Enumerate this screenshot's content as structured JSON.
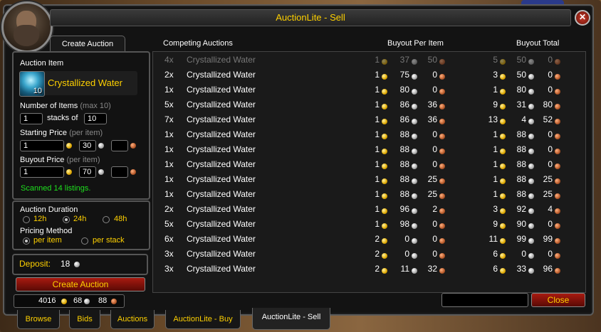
{
  "window": {
    "title": "AuctionLite - Sell",
    "close_symbol": "✕"
  },
  "left": {
    "tab_label": "Create Auction",
    "auction_item_label": "Auction Item",
    "item_name": "Crystallized Water",
    "item_count": "10",
    "num_items_label": "Number of Items",
    "num_items_max": "(max 10)",
    "stacks_value": "1",
    "stacks_of_label": "stacks of",
    "stack_size_value": "10",
    "starting_price_label": "Starting Price",
    "per_item_hint": "(per item)",
    "start_gold": "1",
    "start_silver": "30",
    "start_copper": "",
    "buyout_price_label": "Buyout Price",
    "buyout_gold": "1",
    "buyout_silver": "70",
    "buyout_copper": "",
    "scanned_text": "Scanned 14 listings.",
    "duration_label": "Auction Duration",
    "dur_12": "12h",
    "dur_24": "24h",
    "dur_48": "48h",
    "pricing_label": "Pricing Method",
    "per_item": "per item",
    "per_stack": "per stack",
    "deposit_label": "Deposit:",
    "deposit_value": "18",
    "create_button": "Create Auction",
    "money_gold": "4016",
    "money_silver": "68",
    "money_copper": "88"
  },
  "list": {
    "headers": {
      "competing": "Competing Auctions",
      "per_item": "Buyout Per Item",
      "total": "Buyout Total"
    },
    "rows": [
      {
        "qty": "4x",
        "name": "Crystallized Water",
        "pg": "1",
        "ps": "37",
        "pc": "50",
        "tg": "5",
        "ts": "50",
        "tc": "0",
        "dim": true
      },
      {
        "qty": "2x",
        "name": "Crystallized Water",
        "pg": "1",
        "ps": "75",
        "pc": "0",
        "tg": "3",
        "ts": "50",
        "tc": "0",
        "dim": false
      },
      {
        "qty": "1x",
        "name": "Crystallized Water",
        "pg": "1",
        "ps": "80",
        "pc": "0",
        "tg": "1",
        "ts": "80",
        "tc": "0",
        "dim": false
      },
      {
        "qty": "5x",
        "name": "Crystallized Water",
        "pg": "1",
        "ps": "86",
        "pc": "36",
        "tg": "9",
        "ts": "31",
        "tc": "80",
        "dim": false
      },
      {
        "qty": "7x",
        "name": "Crystallized Water",
        "pg": "1",
        "ps": "86",
        "pc": "36",
        "tg": "13",
        "ts": "4",
        "tc": "52",
        "dim": false
      },
      {
        "qty": "1x",
        "name": "Crystallized Water",
        "pg": "1",
        "ps": "88",
        "pc": "0",
        "tg": "1",
        "ts": "88",
        "tc": "0",
        "dim": false
      },
      {
        "qty": "1x",
        "name": "Crystallized Water",
        "pg": "1",
        "ps": "88",
        "pc": "0",
        "tg": "1",
        "ts": "88",
        "tc": "0",
        "dim": false
      },
      {
        "qty": "1x",
        "name": "Crystallized Water",
        "pg": "1",
        "ps": "88",
        "pc": "0",
        "tg": "1",
        "ts": "88",
        "tc": "0",
        "dim": false
      },
      {
        "qty": "1x",
        "name": "Crystallized Water",
        "pg": "1",
        "ps": "88",
        "pc": "25",
        "tg": "1",
        "ts": "88",
        "tc": "25",
        "dim": false
      },
      {
        "qty": "1x",
        "name": "Crystallized Water",
        "pg": "1",
        "ps": "88",
        "pc": "25",
        "tg": "1",
        "ts": "88",
        "tc": "25",
        "dim": false
      },
      {
        "qty": "2x",
        "name": "Crystallized Water",
        "pg": "1",
        "ps": "96",
        "pc": "2",
        "tg": "3",
        "ts": "92",
        "tc": "4",
        "dim": false
      },
      {
        "qty": "5x",
        "name": "Crystallized Water",
        "pg": "1",
        "ps": "98",
        "pc": "0",
        "tg": "9",
        "ts": "90",
        "tc": "0",
        "dim": false
      },
      {
        "qty": "6x",
        "name": "Crystallized Water",
        "pg": "2",
        "ps": "0",
        "pc": "0",
        "tg": "11",
        "ts": "99",
        "tc": "99",
        "dim": false
      },
      {
        "qty": "3x",
        "name": "Crystallized Water",
        "pg": "2",
        "ps": "0",
        "pc": "0",
        "tg": "6",
        "ts": "0",
        "tc": "0",
        "dim": false
      },
      {
        "qty": "3x",
        "name": "Crystallized Water",
        "pg": "2",
        "ps": "11",
        "pc": "32",
        "tg": "6",
        "ts": "33",
        "tc": "96",
        "dim": false
      }
    ]
  },
  "footer": {
    "close_button": "Close"
  },
  "bottom_tabs": [
    {
      "label": "Browse",
      "active": false
    },
    {
      "label": "Bids",
      "active": false
    },
    {
      "label": "Auctions",
      "active": false
    },
    {
      "label": "AuctionLite - Buy",
      "active": false
    },
    {
      "label": "AuctionLite - Sell",
      "active": true
    }
  ],
  "colors": {
    "gold_text": "#ffd100",
    "scan_green": "#1ee01e",
    "button_red": "#a81a10"
  }
}
